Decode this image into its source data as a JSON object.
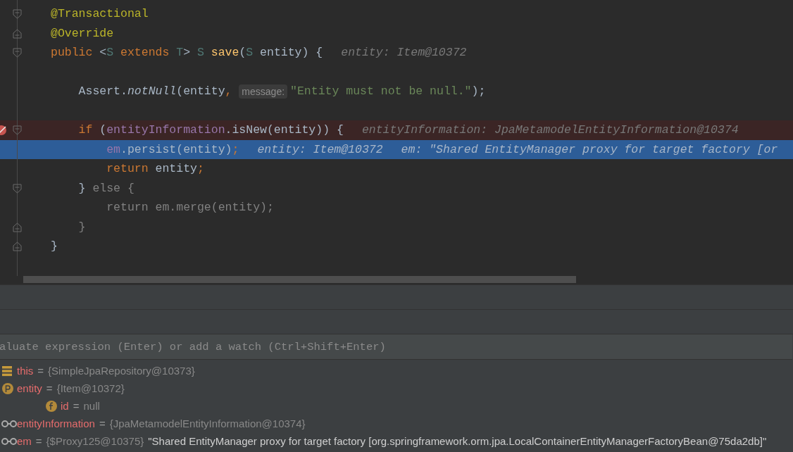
{
  "editor": {
    "lines": [
      {
        "kind": "fold-start",
        "breakpoint": false,
        "current": false,
        "tokens": [
          {
            "text": "@Transactional",
            "kind": "annotation"
          }
        ]
      },
      {
        "kind": "fold-end",
        "breakpoint": false,
        "current": false,
        "tokens": [
          {
            "text": "@Override",
            "kind": "annotation"
          }
        ]
      },
      {
        "kind": "fold-start",
        "breakpoint": false,
        "current": false,
        "tokens": [
          {
            "text": "public ",
            "kind": "keyword"
          },
          {
            "text": "<",
            "kind": "plain"
          },
          {
            "text": "S ",
            "kind": "type"
          },
          {
            "text": "extends ",
            "kind": "keyword"
          },
          {
            "text": "T",
            "kind": "type"
          },
          {
            "text": "> ",
            "kind": "plain"
          },
          {
            "text": "S ",
            "kind": "type"
          },
          {
            "text": "save",
            "kind": "method"
          },
          {
            "text": "(",
            "kind": "plain"
          },
          {
            "text": "S ",
            "kind": "type"
          },
          {
            "text": "entity) {",
            "kind": "plain"
          }
        ],
        "values": [
          "entity: Item@10372"
        ]
      },
      {
        "kind": "plain",
        "breakpoint": false,
        "current": false
      },
      {
        "kind": "plain",
        "breakpoint": false,
        "current": false,
        "tokens": [
          {
            "text": "    Assert.",
            "kind": "plain"
          },
          {
            "text": "notNull",
            "kind": "static"
          },
          {
            "text": "(entity",
            "kind": "plain"
          },
          {
            "text": ", ",
            "kind": "punct"
          },
          {
            "text": "message:",
            "kind": "hint"
          },
          {
            "text": "\"Entity must not be null.\"",
            "kind": "string"
          },
          {
            "text": ");",
            "kind": "plain"
          }
        ]
      },
      {
        "kind": "plain",
        "breakpoint": false,
        "current": false
      },
      {
        "kind": "fold-start",
        "breakpoint": true,
        "current": false,
        "tokens": [
          {
            "text": "    if ",
            "kind": "keyword"
          },
          {
            "text": "(",
            "kind": "plain"
          },
          {
            "text": "entityInformation",
            "kind": "field"
          },
          {
            "text": ".isNew(entity)) {",
            "kind": "plain"
          }
        ],
        "values": [
          "entityInformation: JpaMetamodelEntityInformation@10374"
        ]
      },
      {
        "kind": "plain",
        "breakpoint": false,
        "current": true,
        "tokens": [
          {
            "text": "        em",
            "kind": "field"
          },
          {
            "text": ".persist(entity)",
            "kind": "plain"
          },
          {
            "text": ";",
            "kind": "punct"
          }
        ],
        "values": [
          "entity: Item@10372",
          "em: \"Shared EntityManager proxy for target factory [or"
        ]
      },
      {
        "kind": "plain",
        "breakpoint": false,
        "current": false,
        "tokens": [
          {
            "text": "        return ",
            "kind": "keyword"
          },
          {
            "text": "entity",
            "kind": "plain"
          },
          {
            "text": ";",
            "kind": "punct"
          }
        ]
      },
      {
        "kind": "fold-start",
        "breakpoint": false,
        "current": false,
        "tokens": [
          {
            "text": "    }",
            "kind": "plain"
          },
          {
            "text": " else {",
            "kind": "dim"
          }
        ]
      },
      {
        "kind": "plain",
        "breakpoint": false,
        "current": false,
        "tokens": [
          {
            "text": "        return em.merge(entity);",
            "kind": "dim"
          }
        ]
      },
      {
        "kind": "fold-end",
        "breakpoint": false,
        "current": false,
        "tokens": [
          {
            "text": "    }",
            "kind": "dim"
          }
        ]
      },
      {
        "kind": "fold-end",
        "breakpoint": false,
        "current": false,
        "tokens": [
          {
            "text": "}",
            "kind": "plain"
          }
        ]
      }
    ]
  },
  "debugger": {
    "evaluate": {
      "placeholder": "aluate expression (Enter) or add a watch (Ctrl+Shift+Enter)"
    },
    "variables": [
      {
        "kind": "static",
        "name": "this",
        "equals": "=",
        "value": "{SimpleJpaRepository@10373}"
      },
      {
        "kind": "param",
        "name": "entity",
        "equals": "=",
        "value": "{Item@10372}",
        "children": [
          {
            "kind": "field",
            "name": "id",
            "equals": "=",
            "value": "null"
          }
        ]
      },
      {
        "kind": "watch",
        "name": "entityInformation",
        "equals": "=",
        "value": "{JpaMetamodelEntityInformation@10374}"
      },
      {
        "kind": "watch",
        "name": "em",
        "equals": "=",
        "value": "{$Proxy125@10375}",
        "text": "\"Shared EntityManager proxy for target factory [org.springframework.orm.jpa.LocalContainerEntityManagerFactoryBean@75da2db]\""
      }
    ]
  }
}
